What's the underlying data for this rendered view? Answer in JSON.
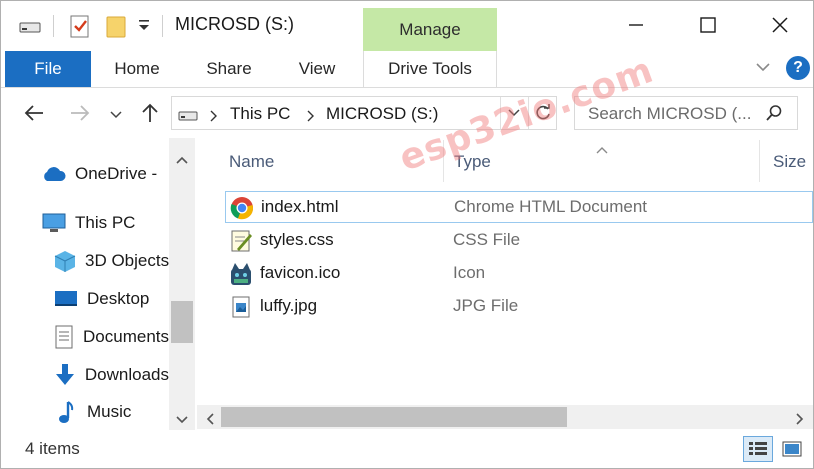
{
  "window": {
    "title": "MICROSD (S:)",
    "context_tab_group": "Manage"
  },
  "ribbon": {
    "tabs": [
      "File",
      "Home",
      "Share",
      "View",
      "Drive Tools"
    ],
    "help_label": "?"
  },
  "nav": {
    "breadcrumb": [
      "This PC",
      "MICROSD (S:)"
    ],
    "search_placeholder": "Search MICROSD (..."
  },
  "sidebar": {
    "items": [
      {
        "label": "OneDrive - ",
        "icon": "cloud-icon"
      },
      {
        "label": "This PC",
        "icon": "computer-icon"
      },
      {
        "label": "3D Objects",
        "icon": "cube-icon"
      },
      {
        "label": "Desktop",
        "icon": "desktop-icon"
      },
      {
        "label": "Documents",
        "icon": "document-icon"
      },
      {
        "label": "Downloads",
        "icon": "download-arrow-icon"
      },
      {
        "label": "Music",
        "icon": "music-note-icon"
      }
    ]
  },
  "columns": {
    "name": "Name",
    "type": "Type",
    "size": "Size"
  },
  "files": [
    {
      "name": "index.html",
      "type": "Chrome HTML Document",
      "icon": "chrome-icon",
      "selected": true
    },
    {
      "name": "styles.css",
      "type": "CSS File",
      "icon": "css-file-icon",
      "selected": false
    },
    {
      "name": "favicon.ico",
      "type": "Icon",
      "icon": "favicon-image-icon",
      "selected": false
    },
    {
      "name": "luffy.jpg",
      "type": "JPG File",
      "icon": "jpg-file-icon",
      "selected": false
    }
  ],
  "status": {
    "item_count": "4 items"
  },
  "watermark": "esp32io.com",
  "colors": {
    "file_tab": "#1b6ec2",
    "manage_tab": "#c5e8a6",
    "selection_border": "#99c9ef"
  }
}
